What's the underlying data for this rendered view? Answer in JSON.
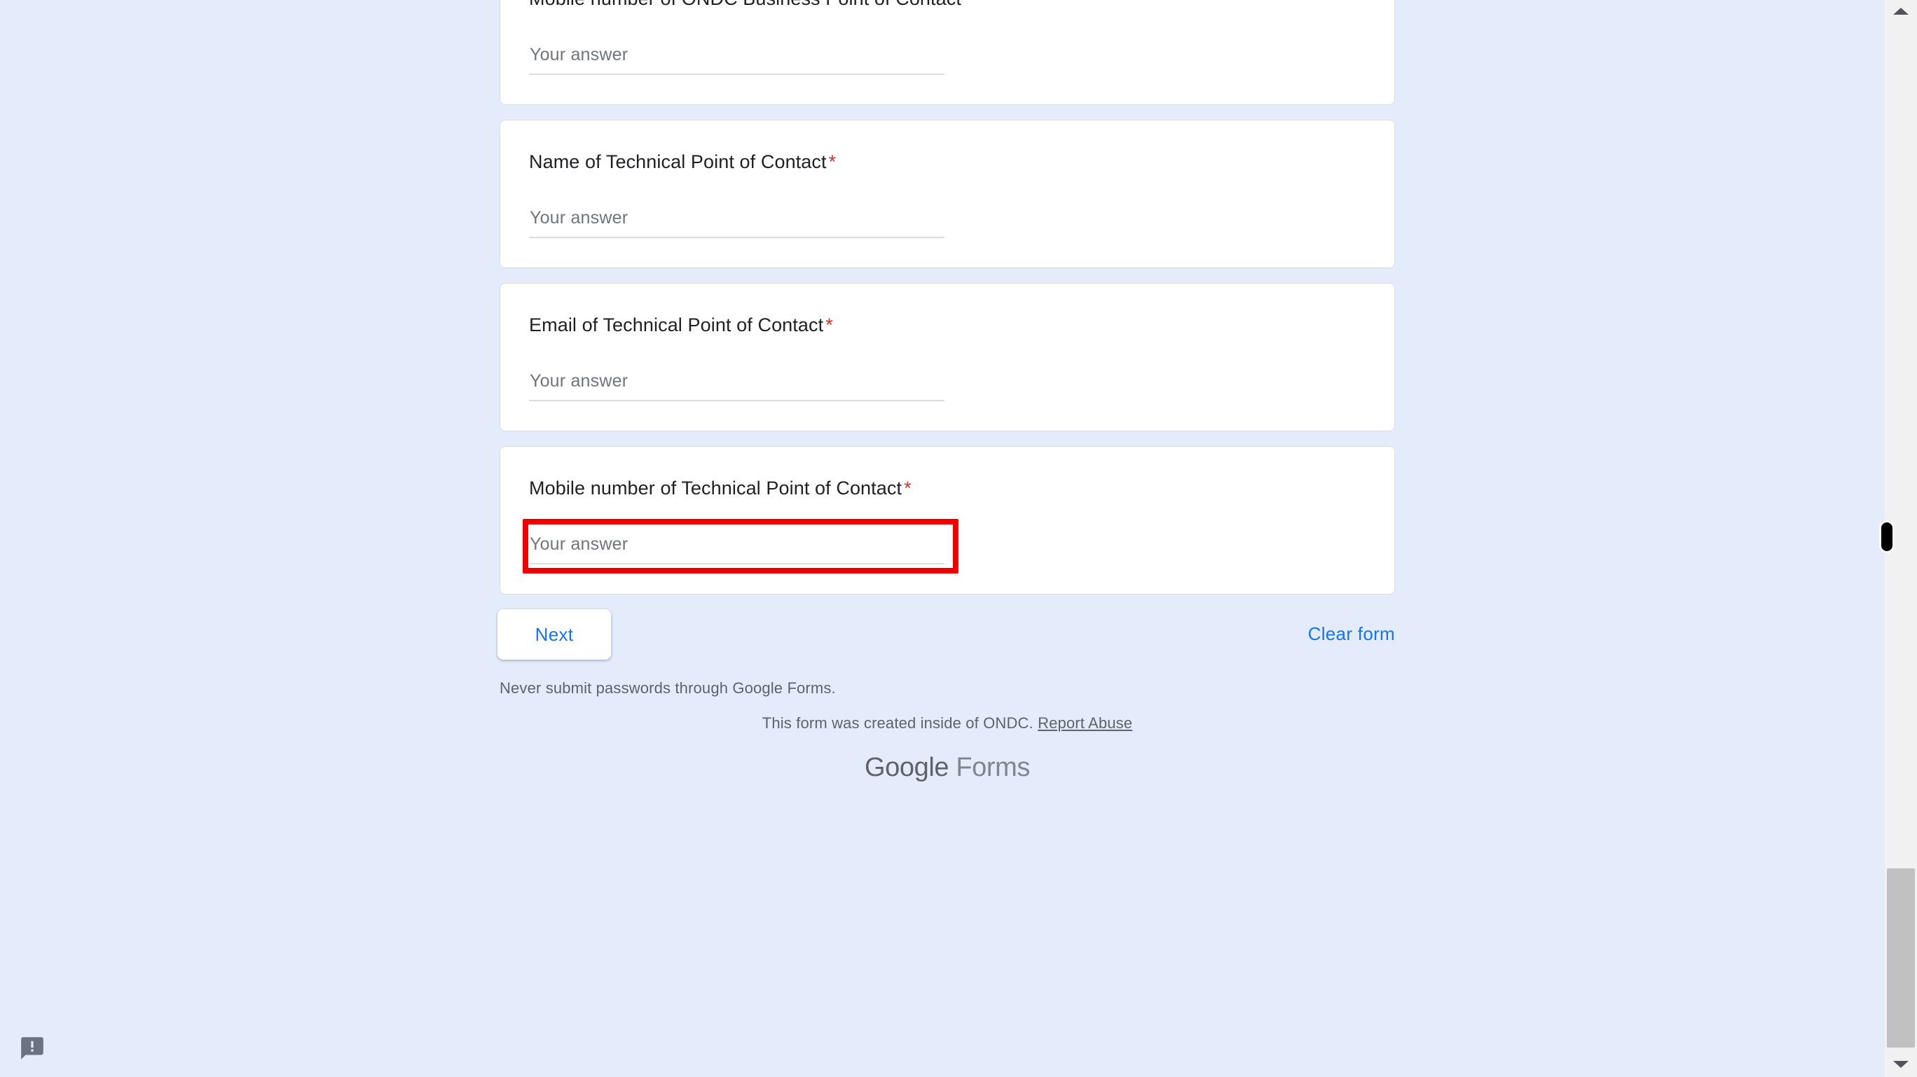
{
  "page": {
    "background_color": "#e4ecfc",
    "accent_color": "#1a73e8",
    "required_color": "#d93025",
    "annotation_color": "#ee0000"
  },
  "questions": [
    {
      "title": "Mobile number of ONDC Business Point of Contact",
      "required_marker": "*",
      "answer_placeholder": "Your answer",
      "answer_value": "",
      "highlighted": false
    },
    {
      "title": "Name of Technical Point of Contact",
      "required_marker": "*",
      "answer_placeholder": "Your answer",
      "answer_value": "",
      "highlighted": false
    },
    {
      "title": "Email of Technical Point of Contact",
      "required_marker": "*",
      "answer_placeholder": "Your answer",
      "answer_value": "",
      "highlighted": false
    },
    {
      "title": "Mobile number of Technical Point of Contact",
      "required_marker": "*",
      "answer_placeholder": "Your answer",
      "answer_value": "",
      "highlighted": true
    }
  ],
  "actions": {
    "next_label": "Next",
    "clear_form_label": "Clear form"
  },
  "footer": {
    "password_warning": "Never submit passwords through Google Forms.",
    "created_inside_text": "This form was created inside of ONDC.",
    "report_abuse_label": "Report Abuse",
    "logo_bold": "Google",
    "logo_light": "Forms"
  },
  "feedback": {
    "icon": "feedback-bubble-icon"
  },
  "scrollbar": {
    "up_arrow_icon": "chevron-up-icon",
    "down_arrow_icon": "chevron-down-icon"
  }
}
